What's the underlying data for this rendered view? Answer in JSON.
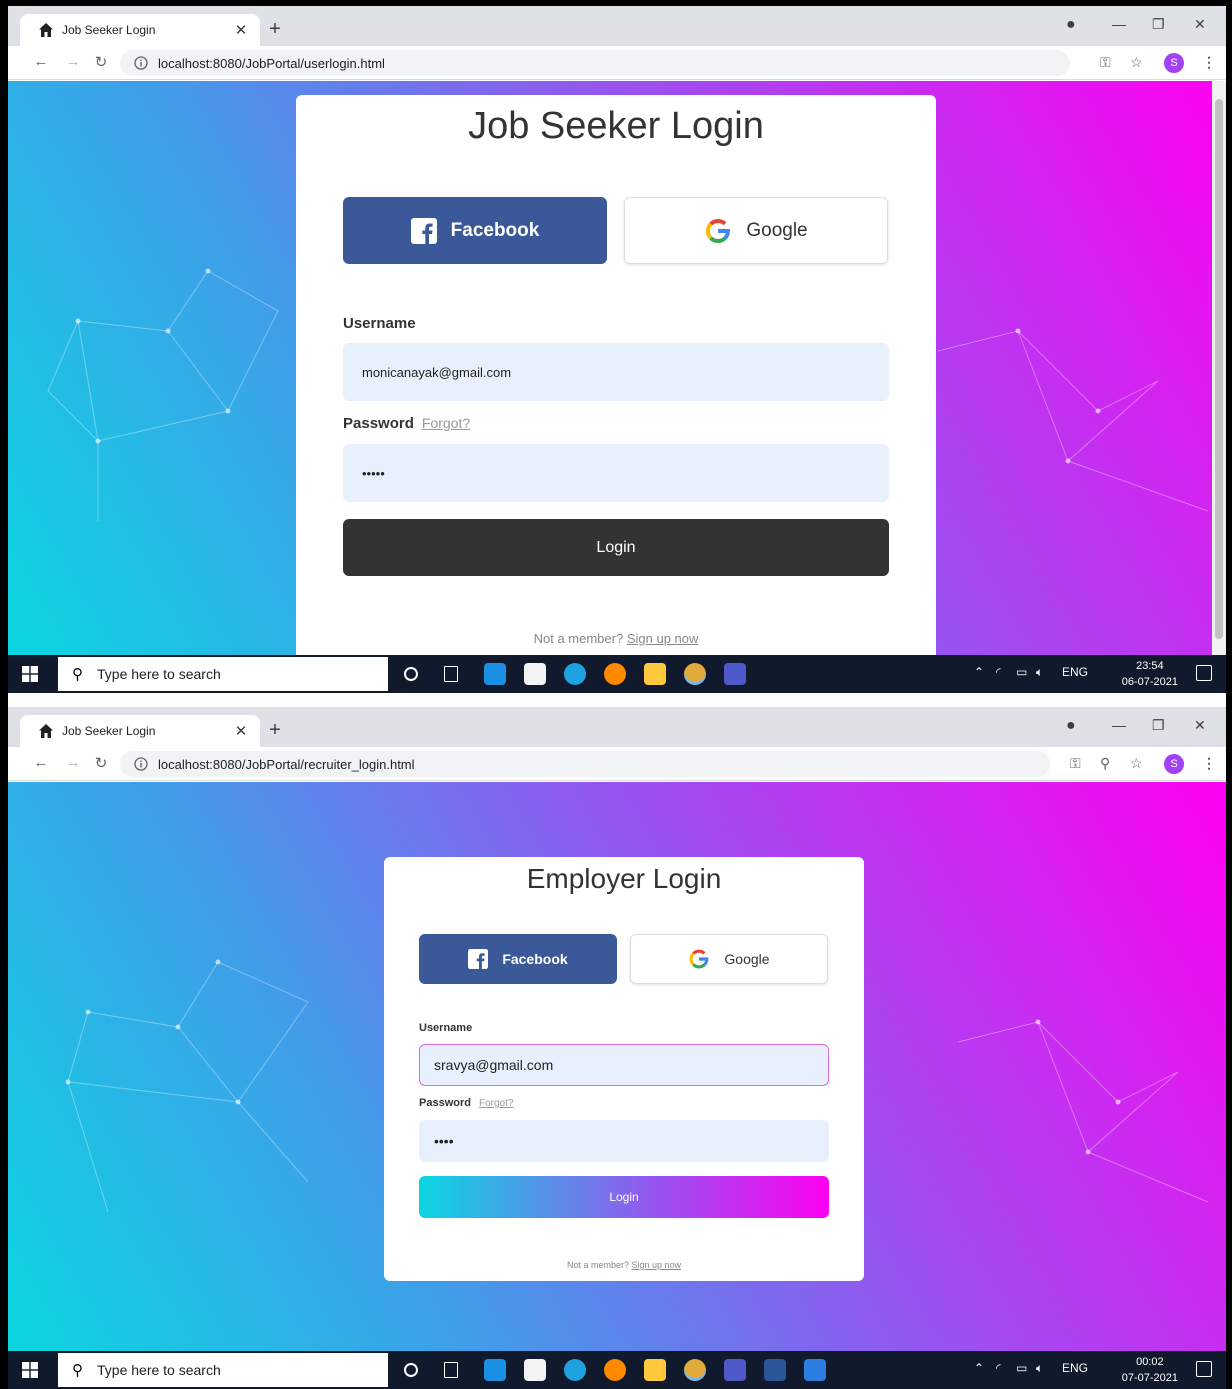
{
  "window1": {
    "tab_title": "Job Seeker Login",
    "url": "localhost:8080/JobPortal/userlogin.html",
    "card": {
      "title": "Job Seeker Login",
      "facebook_label": "Facebook",
      "google_label": "Google",
      "username_label": "Username",
      "username_value": "monicanayak@gmail.com",
      "password_label": "Password",
      "forgot_label": "Forgot?",
      "password_value": "•••••",
      "login_label": "Login",
      "not_member": "Not a member?",
      "signup_label": "Sign up now"
    },
    "taskbar": {
      "search_placeholder": "Type here to search",
      "language": "ENG",
      "time": "23:54",
      "date": "06-07-2021"
    }
  },
  "window2": {
    "tab_title": "Job Seeker Login",
    "url": "localhost:8080/JobPortal/recruiter_login.html",
    "card": {
      "title": "Employer Login",
      "facebook_label": "Facebook",
      "google_label": "Google",
      "username_label": "Username",
      "username_value": "sravya@gmail.com",
      "password_label": "Password",
      "forgot_label": "Forgot?",
      "password_value": "••••",
      "login_label": "Login",
      "not_member": "Not a member?",
      "signup_label": "Sign up now"
    },
    "taskbar": {
      "search_placeholder": "Type here to search",
      "language": "ENG",
      "time": "00:02",
      "date": "07-07-2021"
    }
  },
  "colors": {
    "facebook": "#3b5998",
    "gradient_start": "#0bd6e0",
    "gradient_mid": "#9c50f0",
    "gradient_end": "#ff00f2",
    "dark_button": "#333333",
    "field_bg": "#e8f0fe"
  }
}
